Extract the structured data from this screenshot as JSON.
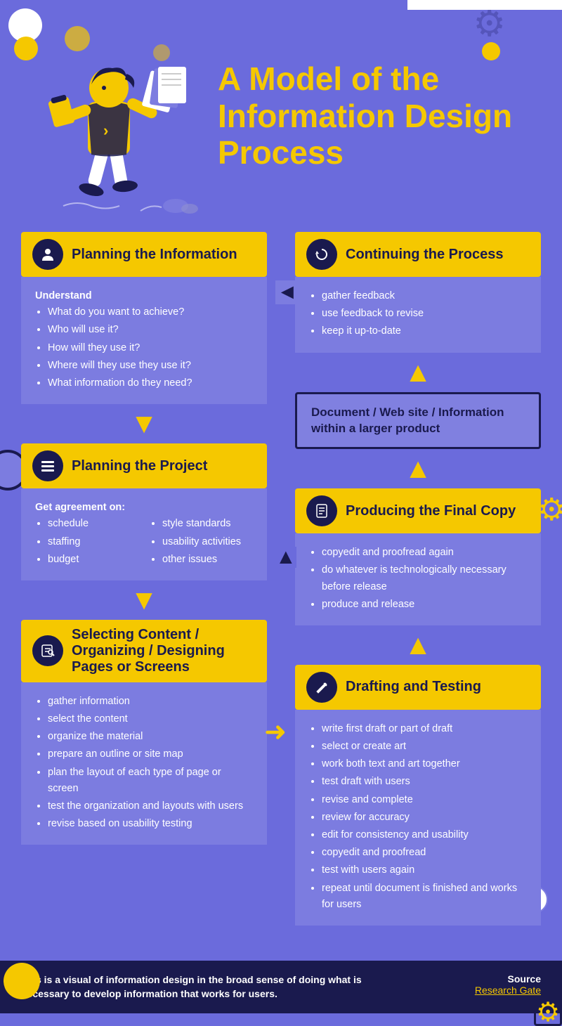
{
  "header": {
    "title": "A Model of the Information Design Process",
    "top_bar": ""
  },
  "sections": {
    "planning_info": {
      "title": "Planning the Information",
      "icon": "👤",
      "understand_label": "Understand",
      "items": [
        "What do you want to achieve?",
        "Who will use it?",
        "How will they use it?",
        "Where will they use they use it?",
        "What information do they need?"
      ]
    },
    "planning_project": {
      "title": "Planning the Project",
      "icon": "≡",
      "get_agreement_label": "Get agreement on:",
      "left_items": [
        "schedule",
        "staffing",
        "budget"
      ],
      "right_items": [
        "style standards",
        "usability activities",
        "other issues"
      ]
    },
    "selecting_content": {
      "title": "Selecting Content / Organizing / Designing Pages or Screens",
      "icon": "✎",
      "items": [
        "gather information",
        "select the content",
        "organize the material",
        "prepare an outline or site map",
        "plan the layout of each type of page or screen",
        "test the organization and layouts with users",
        "revise based on usability testing"
      ]
    },
    "continuing": {
      "title": "Continuing the Process",
      "icon": "↺",
      "items": [
        "gather feedback",
        "use feedback to revise",
        "keep it up-to-date"
      ]
    },
    "doc_type": {
      "text": "Document  /  Web site  /  Information within a larger product"
    },
    "final_copy": {
      "title": "Producing the Final Copy",
      "icon": "📄",
      "items": [
        "copyedit and proofread again",
        "do whatever is technologically necessary before release",
        "produce and release"
      ]
    },
    "drafting": {
      "title": "Drafting and Testing",
      "icon": "✏",
      "items": [
        "write first draft or part of draft",
        "select or create art",
        "work both text and art together",
        "test draft with users",
        "revise and complete",
        "review for accuracy",
        "edit for consistency and usability",
        "copyedit and proofread",
        "test with users again",
        "repeat until document is finished and works for users"
      ]
    }
  },
  "footer": {
    "description": "This is a visual of information design in the broad sense of doing what is necessary to develop information that works for users.",
    "source_label": "Source",
    "source_link": "Research Gate"
  },
  "decorative": {
    "gear_symbol": "⚙",
    "circle_symbol": "●"
  }
}
